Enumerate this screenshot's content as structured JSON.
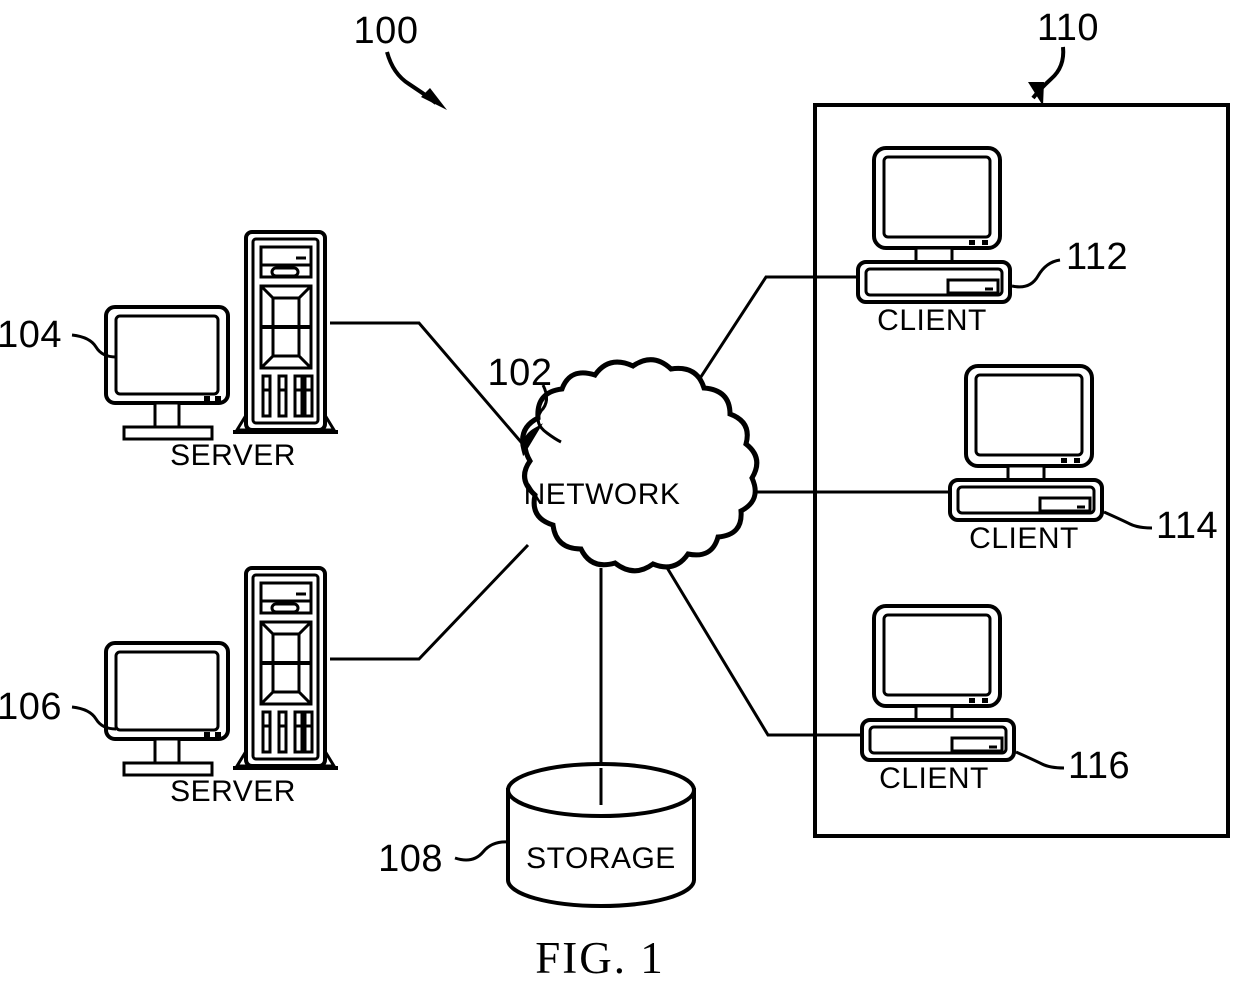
{
  "figure": {
    "caption": "FIG. 1",
    "system_ref": "100",
    "client_group_ref": "110"
  },
  "nodes": {
    "network": {
      "label": "NETWORK",
      "ref": "102",
      "icon": "cloud-icon"
    },
    "storage": {
      "label": "STORAGE",
      "ref": "108",
      "icon": "cylinder-database-icon"
    },
    "server_top": {
      "label": "SERVER",
      "ref": "104",
      "icon": "server-tower-icon"
    },
    "server_bottom": {
      "label": "SERVER",
      "ref": "106",
      "icon": "server-tower-icon"
    },
    "client_top": {
      "label": "CLIENT",
      "ref": "112",
      "icon": "desktop-computer-icon"
    },
    "client_middle": {
      "label": "CLIENT",
      "ref": "114",
      "icon": "desktop-computer-icon"
    },
    "client_bottom": {
      "label": "CLIENT",
      "ref": "116",
      "icon": "desktop-computer-icon"
    }
  },
  "connections": [
    {
      "from": "server_top",
      "to": "network"
    },
    {
      "from": "server_bottom",
      "to": "network"
    },
    {
      "from": "network",
      "to": "storage"
    },
    {
      "from": "network",
      "to": "client_top"
    },
    {
      "from": "network",
      "to": "client_middle"
    },
    {
      "from": "network",
      "to": "client_bottom"
    }
  ],
  "colors": {
    "ink": "#000000",
    "paper": "#ffffff"
  }
}
